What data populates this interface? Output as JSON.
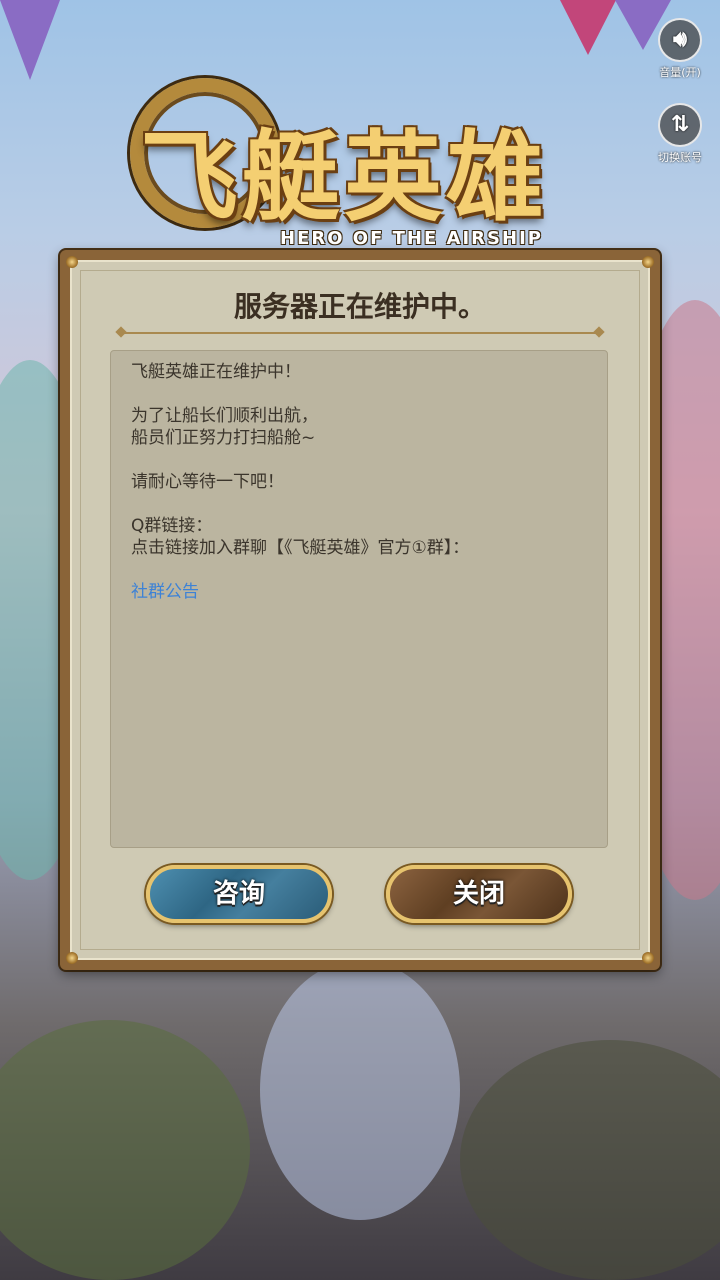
{
  "logo": {
    "title": "飞艇英雄",
    "subtitle": "HERO OF THE AIRSHIP"
  },
  "side_buttons": {
    "volume_label": "音量(开)",
    "switch_account_label": "切换账号"
  },
  "dialog": {
    "title": "服务器正在维护中。",
    "lines": {
      "p1": "飞艇英雄正在维护中！",
      "p2a": "为了让船长们顺利出航，",
      "p2b": "船员们正努力打扫船舱~",
      "p3": "请耐心等待一下吧！",
      "p4a": "Q群链接：",
      "p4b": "点击链接加入群聊【《飞艇英雄》官方①群】：",
      "link": "社群公告"
    },
    "buttons": {
      "consult": "咨询",
      "close": "关闭"
    }
  },
  "colors": {
    "panel_frame": "#8a6438",
    "panel_bg": "#cfcab4",
    "link": "#3d82d6",
    "consult_button": "#2e6684",
    "close_button": "#5f3f22"
  }
}
